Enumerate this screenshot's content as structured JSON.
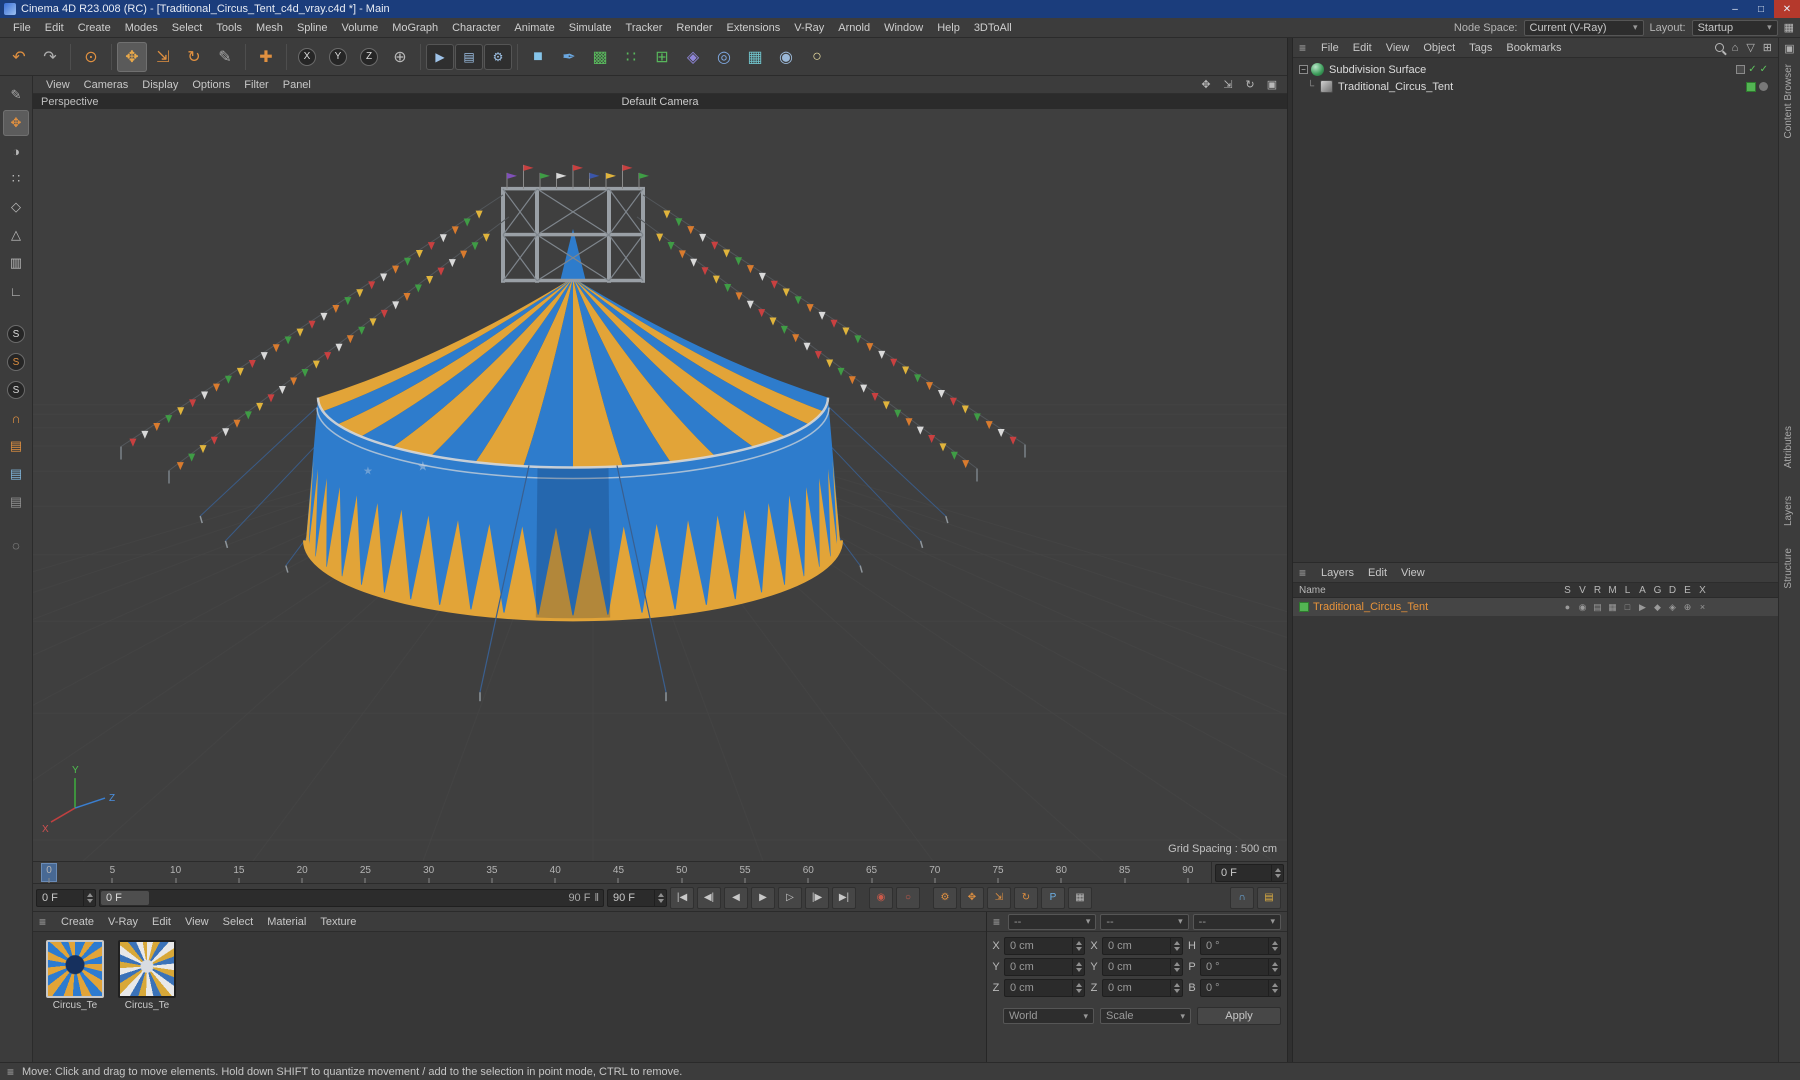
{
  "window": {
    "title": "Cinema 4D R23.008 (RC) - [Traditional_Circus_Tent_c4d_vray.c4d *] - Main",
    "minimize": "–",
    "maximize": "□",
    "close": "✕"
  },
  "menubar": {
    "items": [
      "File",
      "Edit",
      "Create",
      "Modes",
      "Select",
      "Tools",
      "Mesh",
      "Spline",
      "Volume",
      "MoGraph",
      "Character",
      "Animate",
      "Simulate",
      "Tracker",
      "Render",
      "Extensions",
      "V-Ray",
      "Arnold",
      "Window",
      "Help",
      "3DToAll"
    ],
    "node_space_label": "Node Space:",
    "node_space_value": "Current (V-Ray)",
    "layout_label": "Layout:",
    "layout_value": "Startup"
  },
  "toolbar": {
    "buttons": [
      {
        "name": "undo",
        "glyph": "↶",
        "color": "#e09040"
      },
      {
        "name": "redo",
        "glyph": "↷",
        "color": "#b0b0b0"
      },
      {
        "divider": true
      },
      {
        "name": "live-selection",
        "glyph": "⊙",
        "color": "#e09040"
      },
      {
        "divider": true
      },
      {
        "name": "move-tool",
        "glyph": "✥",
        "color": "#e8a84a",
        "active": true
      },
      {
        "name": "scale-tool",
        "glyph": "⇲",
        "color": "#e09040"
      },
      {
        "name": "rotate-tool",
        "glyph": "↻",
        "color": "#e09040"
      },
      {
        "name": "last-tool",
        "glyph": "✎",
        "color": "#a8a8a8"
      },
      {
        "divider": true
      },
      {
        "name": "add-tool",
        "glyph": "✚",
        "color": "#e09040"
      },
      {
        "divider": true
      },
      {
        "name": "lock-x",
        "glyph": "X",
        "circle": true
      },
      {
        "name": "lock-y",
        "glyph": "Y",
        "circle": true
      },
      {
        "name": "lock-z",
        "glyph": "Z",
        "circle": true
      },
      {
        "name": "coordinate-system",
        "glyph": "⊕",
        "color": "#b8b8b8"
      },
      {
        "divider": true
      },
      {
        "name": "render-view",
        "glyph": "▶",
        "box": true,
        "color": "#9fc3e8"
      },
      {
        "name": "render-picture-viewer",
        "glyph": "▤",
        "box": true,
        "color": "#9fc3e8"
      },
      {
        "name": "render-settings",
        "glyph": "⚙",
        "box": true,
        "color": "#9fc3e8"
      },
      {
        "divider": true
      },
      {
        "name": "add-cube",
        "glyph": "■",
        "color": "#86c5ea"
      },
      {
        "name": "add-spline",
        "glyph": "✒",
        "color": "#6aa7e0"
      },
      {
        "name": "add-subdivision-surface",
        "glyph": "▩",
        "color": "#58b75c"
      },
      {
        "name": "add-array",
        "glyph": "∷",
        "color": "#58b75c"
      },
      {
        "name": "add-cloner",
        "glyph": "⊞",
        "color": "#58b75c"
      },
      {
        "name": "add-deformer",
        "glyph": "◈",
        "color": "#8f86d8"
      },
      {
        "name": "add-volume",
        "glyph": "◎",
        "color": "#7fa8e0"
      },
      {
        "name": "add-field",
        "glyph": "▦",
        "color": "#6fc0c8"
      },
      {
        "name": "add-camera",
        "glyph": "◉",
        "color": "#9ab8d8"
      },
      {
        "name": "add-light",
        "glyph": "○",
        "color": "#e8dca0"
      }
    ]
  },
  "left_toolbar": {
    "buttons": [
      {
        "name": "convert-tool",
        "glyph": "✎",
        "color": "#a8a8a8"
      },
      {
        "name": "model-mode",
        "glyph": "✥",
        "color": "#e09040",
        "active": true
      },
      {
        "name": "texture-mode",
        "glyph": "◑",
        "color": "#b8b8b8"
      },
      {
        "name": "points-mode",
        "glyph": "∷",
        "color": "#b8b8b8"
      },
      {
        "name": "edges-mode",
        "glyph": "◇",
        "color": "#b8b8b8"
      },
      {
        "name": "polygons-mode",
        "glyph": "△",
        "color": "#b8b8b8"
      },
      {
        "name": "uv-mode",
        "glyph": "▥",
        "color": "#b8b8b8"
      },
      {
        "name": "axis-mode",
        "glyph": "∟",
        "color": "#b8b8b8"
      },
      {
        "gap": true
      },
      {
        "name": "snap-3d",
        "glyph": "S",
        "circle": true
      },
      {
        "name": "snap-2d",
        "glyph": "S",
        "circle": true,
        "color": "#e09040"
      },
      {
        "name": "snap-auto",
        "glyph": "S",
        "circle": true
      },
      {
        "name": "enable-snapping",
        "glyph": "∩",
        "color": "#e09040"
      },
      {
        "name": "workplane-mode",
        "glyph": "▤",
        "color": "#e09040"
      },
      {
        "name": "locked-workplane",
        "glyph": "▤",
        "color": "#7fb3d8"
      },
      {
        "name": "planar-workplane",
        "glyph": "▤",
        "color": "#909090"
      },
      {
        "gap": true
      },
      {
        "name": "viewport-solo",
        "glyph": "◌",
        "color": "#b8b8b8"
      }
    ]
  },
  "viewport": {
    "menus": [
      "View",
      "Cameras",
      "Display",
      "Options",
      "Filter",
      "Panel"
    ],
    "nav_icons": [
      {
        "name": "pan-view-icon",
        "glyph": "✥"
      },
      {
        "name": "zoom-view-icon",
        "glyph": "⇲"
      },
      {
        "name": "rotate-view-icon",
        "glyph": "↻"
      },
      {
        "name": "maximize-view-icon",
        "glyph": "▣"
      }
    ],
    "projection_label": "Perspective",
    "camera_label": "Default Camera",
    "grid_spacing": "Grid Spacing : 500 cm",
    "axis_labels": {
      "x": "X",
      "y": "Y",
      "z": "Z"
    }
  },
  "timeline": {
    "ticks": [
      "0",
      "5",
      "10",
      "15",
      "20",
      "25",
      "30",
      "35",
      "40",
      "45",
      "50",
      "55",
      "60",
      "65",
      "70",
      "75",
      "80",
      "85",
      "90"
    ],
    "frame_display": "0 F"
  },
  "transport": {
    "current_frame": "0 F",
    "slider_handle_label": "0 F",
    "slider_end_label": "90 F",
    "end_frame": "90 F",
    "buttons": [
      {
        "name": "goto-start-button",
        "glyph": "|◀"
      },
      {
        "name": "prev-key-button",
        "glyph": "◀|"
      },
      {
        "name": "prev-frame-button",
        "glyph": "◀"
      },
      {
        "name": "play-button",
        "glyph": "▶"
      },
      {
        "name": "next-frame-button",
        "glyph": "▷"
      },
      {
        "name": "next-key-button",
        "glyph": "|▶"
      },
      {
        "name": "goto-end-button",
        "glyph": "▶|"
      }
    ],
    "record_buttons": [
      {
        "name": "record-keyframe-button",
        "glyph": "◉",
        "color": "#cc5a4a"
      },
      {
        "name": "autokey-button",
        "glyph": "○",
        "color": "#cc5a4a"
      }
    ],
    "key_toggles": [
      {
        "name": "keyframe-selection-toggle",
        "glyph": "⚙",
        "color": "#e09040"
      },
      {
        "name": "position-key-toggle",
        "glyph": "✥",
        "color": "#e09040"
      },
      {
        "name": "scale-key-toggle",
        "glyph": "⇲",
        "color": "#e09040"
      },
      {
        "name": "rotation-key-toggle",
        "glyph": "↻",
        "color": "#e09040"
      },
      {
        "name": "parameter-key-toggle",
        "glyph": "P",
        "color": "#6db1e8"
      },
      {
        "name": "pla-key-toggle",
        "glyph": "▦",
        "color": "#b8b8b8"
      }
    ],
    "right_buttons": [
      {
        "name": "snap-magnet-button",
        "glyph": "∩",
        "color": "#6db1e8"
      },
      {
        "name": "layer-stack-button",
        "glyph": "▤",
        "color": "#e0b040"
      }
    ]
  },
  "materials": {
    "menus": [
      "Create",
      "V-Ray",
      "Edit",
      "View",
      "Select",
      "Material",
      "Texture"
    ],
    "items": [
      {
        "label": "Circus_Te",
        "selected": true
      },
      {
        "label": "Circus_Te",
        "selected": false
      }
    ]
  },
  "coordinates": {
    "header_dropdowns": [
      "--",
      "--",
      "--"
    ],
    "rows": [
      {
        "cells": [
          {
            "label": "X",
            "value": "0 cm"
          },
          {
            "label": "X",
            "value": "0 cm"
          },
          {
            "label": "H",
            "value": "0 °"
          }
        ]
      },
      {
        "cells": [
          {
            "label": "Y",
            "value": "0 cm"
          },
          {
            "label": "Y",
            "value": "0 cm"
          },
          {
            "label": "P",
            "value": "0 °"
          }
        ]
      },
      {
        "cells": [
          {
            "label": "Z",
            "value": "0 cm"
          },
          {
            "label": "Z",
            "value": "0 cm"
          },
          {
            "label": "B",
            "value": "0 °"
          }
        ]
      }
    ],
    "world": "World",
    "scale": "Scale",
    "apply": "Apply"
  },
  "object_manager": {
    "menus": [
      "File",
      "Edit",
      "View",
      "Object",
      "Tags",
      "Bookmarks"
    ],
    "items": [
      {
        "label": "Subdivision Surface",
        "level": 0
      },
      {
        "label": "Traditional_Circus_Tent",
        "level": 1
      }
    ]
  },
  "layers_panel": {
    "menus": [
      "Layers",
      "Edit",
      "View"
    ],
    "name_header": "Name",
    "columns": [
      "S",
      "V",
      "R",
      "M",
      "L",
      "A",
      "G",
      "D",
      "E",
      "X"
    ],
    "row_icons": [
      {
        "name": "solo",
        "glyph": "●"
      },
      {
        "name": "view",
        "glyph": "◉"
      },
      {
        "name": "render",
        "glyph": "▤"
      },
      {
        "name": "manager",
        "glyph": "▦"
      },
      {
        "name": "lock",
        "glyph": "□"
      },
      {
        "name": "animation",
        "glyph": "▶"
      },
      {
        "name": "generators",
        "glyph": "◆"
      },
      {
        "name": "deformers",
        "glyph": "◈"
      },
      {
        "name": "expressions",
        "glyph": "⊕"
      },
      {
        "name": "xref",
        "glyph": "×"
      }
    ],
    "rows": [
      {
        "label": "Traditional_Circus_Tent",
        "color": "#e8933a"
      }
    ]
  },
  "right_tabs": [
    "Content Browser",
    "Attributes",
    "Layers",
    "Structure"
  ],
  "statusbar": {
    "text": "Move: Click and drag to move elements. Hold down SHIFT to quantize movement / add to the selection in point mode, CTRL to remove."
  },
  "scene": {
    "bg": "#3f3f3f",
    "grid": "#4a4a4a",
    "tent_blue": "#2e7ccc",
    "tent_yellow": "#e2a438",
    "trim": "#d8d8d8",
    "truss": "#9aa0a6",
    "rope": "#3a5f8f",
    "bunting_colors": [
      "#d9d9d9",
      "#c94040",
      "#e0b43c",
      "#3f9c45",
      "#d97b2e"
    ],
    "flag_colors": [
      "#8050b8",
      "#c84040",
      "#3f9c45",
      "#d9d9d9",
      "#c84040",
      "#3a55a8",
      "#e0b43c",
      "#c84040",
      "#3f9c45"
    ]
  }
}
